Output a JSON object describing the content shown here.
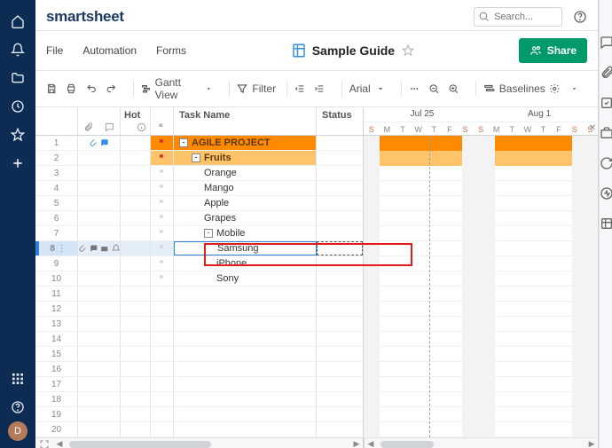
{
  "brand": "smartsheet",
  "search": {
    "placeholder": "Search..."
  },
  "menu": {
    "file": "File",
    "automation": "Automation",
    "forms": "Forms"
  },
  "doc": {
    "title": "Sample Guide"
  },
  "share": {
    "label": "Share"
  },
  "toolbar": {
    "view_label": "Gantt View",
    "filter_label": "Filter",
    "font_label": "Arial",
    "baselines_label": "Baselines"
  },
  "cols": {
    "hot": "Hot",
    "task": "Task Name",
    "status": "Status"
  },
  "gantt": {
    "month1": "Jul 25",
    "month2": "Aug 1",
    "days": [
      "S",
      "M",
      "T",
      "W",
      "T",
      "F",
      "S",
      "S",
      "M",
      "T",
      "W",
      "T",
      "F",
      "S",
      "S"
    ]
  },
  "rows": [
    {
      "n": "1",
      "task": "AGILE PROJECT",
      "indent": 0,
      "exp": "-",
      "type": "project",
      "flag": "red",
      "ind": "comment"
    },
    {
      "n": "2",
      "task": "Fruits",
      "indent": 1,
      "exp": "-",
      "type": "section",
      "flag": "red"
    },
    {
      "n": "3",
      "task": "Orange",
      "indent": 2,
      "flag": "gray"
    },
    {
      "n": "4",
      "task": "Mango",
      "indent": 2,
      "flag": "gray"
    },
    {
      "n": "5",
      "task": "Apple",
      "indent": 2,
      "flag": "gray"
    },
    {
      "n": "6",
      "task": "Grapes",
      "indent": 2,
      "flag": "gray"
    },
    {
      "n": "7",
      "task": "Mobile",
      "indent": 2,
      "exp": "-",
      "type": "sub",
      "flag": "gray"
    },
    {
      "n": "8",
      "task": "Samsung",
      "indent": 3,
      "flag": "gray",
      "selected": true
    },
    {
      "n": "9",
      "task": "iPhone",
      "indent": 3,
      "flag": "gray"
    },
    {
      "n": "10",
      "task": "Sony",
      "indent": 3,
      "flag": "gray"
    },
    {
      "n": "11"
    },
    {
      "n": "12"
    },
    {
      "n": "13"
    },
    {
      "n": "14"
    },
    {
      "n": "15"
    },
    {
      "n": "16"
    },
    {
      "n": "17"
    },
    {
      "n": "18"
    },
    {
      "n": "19"
    },
    {
      "n": "20"
    }
  ],
  "avatar": {
    "initial": "D"
  }
}
